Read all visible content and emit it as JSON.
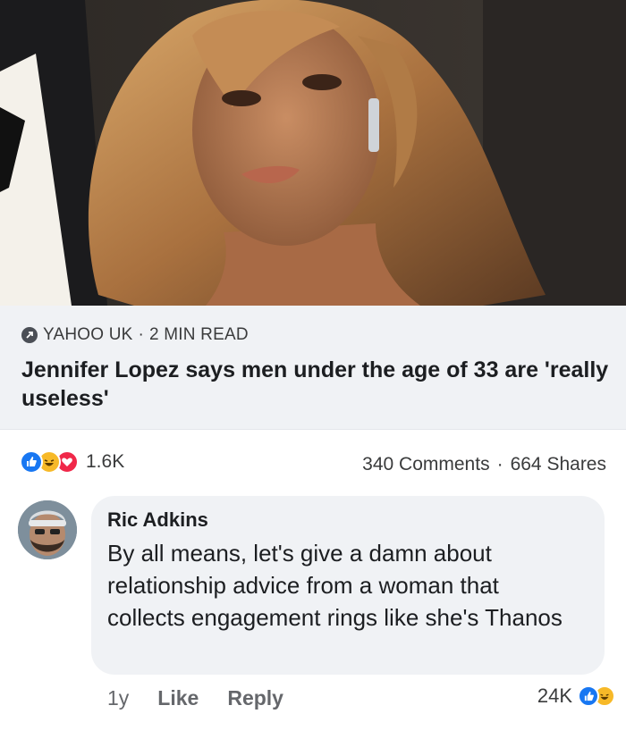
{
  "post": {
    "image_alt_subject": "celebrity photo",
    "source": "YAHOO UK",
    "read_time": "2 MIN READ",
    "separator": "·",
    "headline": "Jennifer Lopez says men under the age of 33 are 'really useless'"
  },
  "stats": {
    "reaction_count": "1.6K",
    "reactions": [
      "like",
      "haha",
      "love"
    ],
    "comments": "340 Comments",
    "separator": "·",
    "shares": "664 Shares"
  },
  "comment": {
    "author": "Ric Adkins",
    "text": "By all means,  let's give a damn about relationship advice from a woman that collects engagement rings like she's Thanos",
    "age": "1y",
    "like_label": "Like",
    "reply_label": "Reply",
    "reaction_count": "24K",
    "reactions": [
      "like",
      "haha"
    ]
  },
  "colors": {
    "like_blue": "#1877f2",
    "haha_yellow": "#f7b928",
    "love_red": "#f02849",
    "bubble_bg": "#f0f2f5"
  }
}
